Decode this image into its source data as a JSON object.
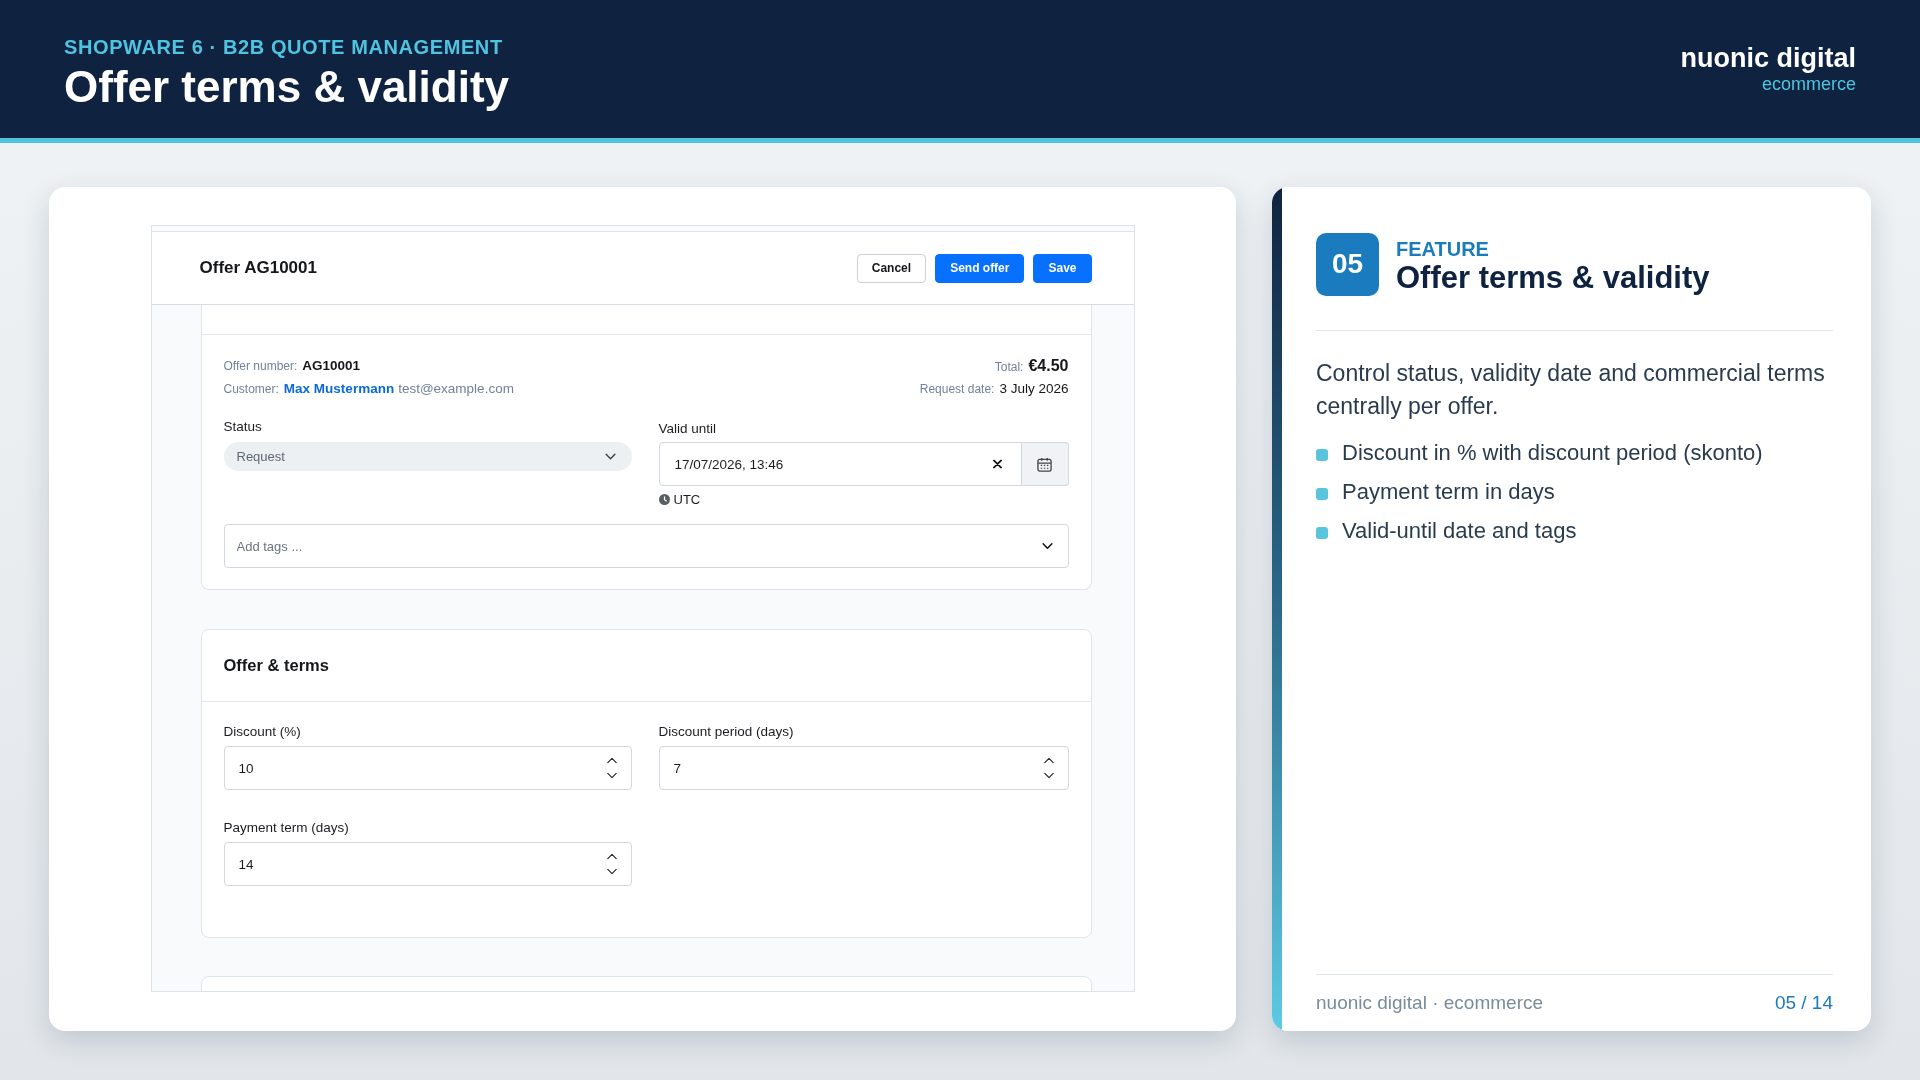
{
  "header": {
    "eyebrow": "SHOPWARE 6 · B2B QUOTE MANAGEMENT",
    "title": "Offer terms & validity",
    "brand": {
      "name": "nuonic digital",
      "tagline": "ecommerce"
    }
  },
  "screenshot": {
    "title": "Offer AG10001",
    "buttons": [
      {
        "label": "Cancel",
        "kind": "secondary"
      },
      {
        "label": "Send offer",
        "kind": "primary"
      },
      {
        "label": "Save",
        "kind": "primary"
      }
    ],
    "info": {
      "offer_number": {
        "label": "Offer number:",
        "value": "AG10001"
      },
      "customer": {
        "label": "Customer:",
        "name": "Max Mustermann",
        "email": "test@example.com"
      },
      "total": {
        "label": "Total:",
        "value": "€4.50"
      },
      "request_date": {
        "label": "Request date:",
        "value": "3 July 2026"
      },
      "status": {
        "label": "Status",
        "value": "Request"
      },
      "valid_until": {
        "label": "Valid until",
        "value": "17/07/2026, 13:46",
        "timezone": "UTC"
      },
      "tags": {
        "placeholder": "Add tags ..."
      }
    },
    "terms": {
      "title": "Offer & terms",
      "fields": [
        {
          "label": "Discount (%)",
          "value": "10"
        },
        {
          "label": "Discount period (days)",
          "value": "7"
        },
        {
          "label": "Payment term (days)",
          "value": "14"
        }
      ]
    }
  },
  "feature": {
    "number": "05",
    "eyebrow": "FEATURE",
    "title": "Offer terms & validity",
    "description": "Control status, validity date and commercial terms centrally per offer.",
    "bullets": [
      "Discount in % with discount period (skonto)",
      "Payment term in days",
      "Valid-until date and tags"
    ],
    "footer": {
      "brand": "nuonic digital · ecommerce",
      "page": "05 / 14"
    }
  }
}
